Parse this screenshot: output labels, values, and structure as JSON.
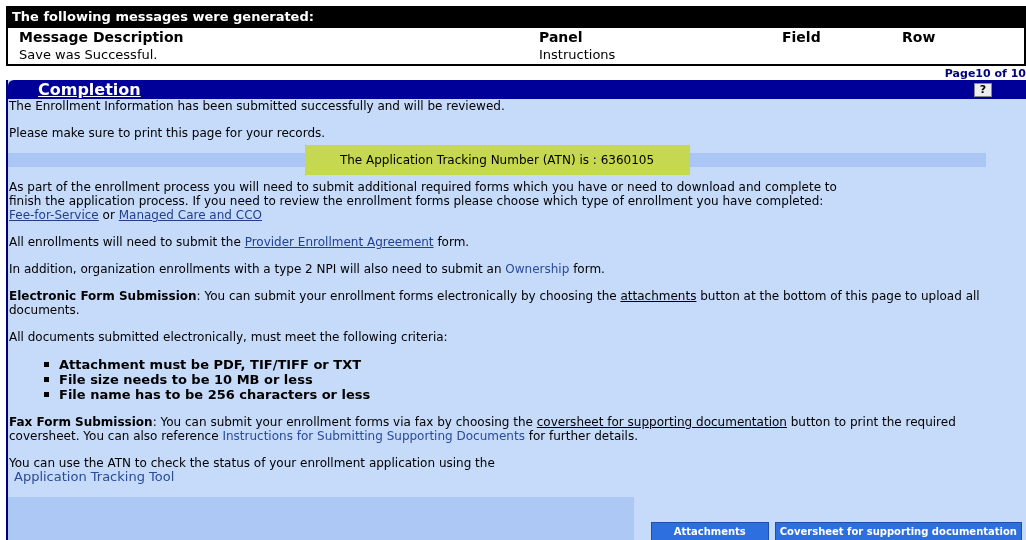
{
  "messages": {
    "title": "The following messages were generated:",
    "columns": [
      "Message Description",
      "Panel",
      "Field",
      "Row"
    ],
    "rows": [
      [
        "Save was Successful.",
        "Instructions",
        "",
        ""
      ]
    ]
  },
  "page_indicator": "Page10 of 10",
  "section": {
    "title": "Completion",
    "help": "?"
  },
  "blocks": [
    {
      "kind": "para",
      "segments": [
        {
          "kind": "text",
          "text": "The Enrollment Information has been submitted successfully and will be reviewed."
        }
      ]
    },
    {
      "kind": "para",
      "segments": [
        {
          "kind": "text",
          "text": "Please make sure to print this page for your records."
        }
      ]
    },
    {
      "kind": "atn",
      "text": "The Application Tracking Number (ATN) is : 6360105"
    },
    {
      "kind": "para",
      "segments": [
        {
          "kind": "text",
          "text": "As part of the enrollment process you will need to submit additional required forms which you have or need to download and complete to finish the application process. If you need to review the enrollment forms please choose which type of enrollment you have completed:"
        },
        {
          "kind": "break"
        },
        {
          "kind": "link",
          "text": "Fee-for-Service"
        },
        {
          "kind": "text",
          "text": " or "
        },
        {
          "kind": "link",
          "text": "Managed Care and CCO"
        }
      ]
    },
    {
      "kind": "para",
      "segments": [
        {
          "kind": "text",
          "text": "All enrollments will need to submit the "
        },
        {
          "kind": "link",
          "text": "Provider Enrollment Agreement"
        },
        {
          "kind": "text",
          "text": " form."
        }
      ]
    },
    {
      "kind": "para",
      "segments": [
        {
          "kind": "text",
          "text": "In addition, organization enrollments with a type 2 NPI will also need to submit an "
        },
        {
          "kind": "plain_link",
          "text": "Ownership"
        },
        {
          "kind": "text",
          "text": " form."
        }
      ]
    },
    {
      "kind": "para",
      "segments": [
        {
          "kind": "bold",
          "text": "Electronic Form Submission"
        },
        {
          "kind": "text",
          "text": ": You can submit your enrollment forms electronically by choosing the "
        },
        {
          "kind": "dark_link",
          "text": "attachments"
        },
        {
          "kind": "text",
          "text": " button at the bottom of this page to upload all documents."
        }
      ]
    },
    {
      "kind": "para",
      "segments": [
        {
          "kind": "text",
          "text": "All documents submitted electronically, must meet the following criteria:"
        }
      ]
    },
    {
      "kind": "list",
      "items": [
        "Attachment must be PDF, TIF/TIFF or TXT",
        "File size needs to be 10 MB or less",
        "File name has to be 256 characters or less"
      ]
    },
    {
      "kind": "para",
      "segments": [
        {
          "kind": "bold",
          "text": "Fax Form Submission"
        },
        {
          "kind": "text",
          "text": ": You can submit your enrollment forms via fax by choosing the "
        },
        {
          "kind": "dark_link",
          "text": "coversheet for supporting documentation"
        },
        {
          "kind": "text",
          "text": " button to print the required coversheet. You can also reference "
        },
        {
          "kind": "plain_link",
          "text": "Instructions for Submitting Supporting Documents"
        },
        {
          "kind": "text",
          "text": " for further details."
        }
      ]
    },
    {
      "kind": "para",
      "segments": [
        {
          "kind": "text",
          "text": "You can use the ATN to check the status of your enrollment application using the"
        },
        {
          "kind": "break"
        },
        {
          "kind": "plain_link",
          "text": "Application Tracking Tool"
        }
      ]
    }
  ],
  "buttons": [
    "Attachments",
    "Coversheet for supporting documentation"
  ]
}
